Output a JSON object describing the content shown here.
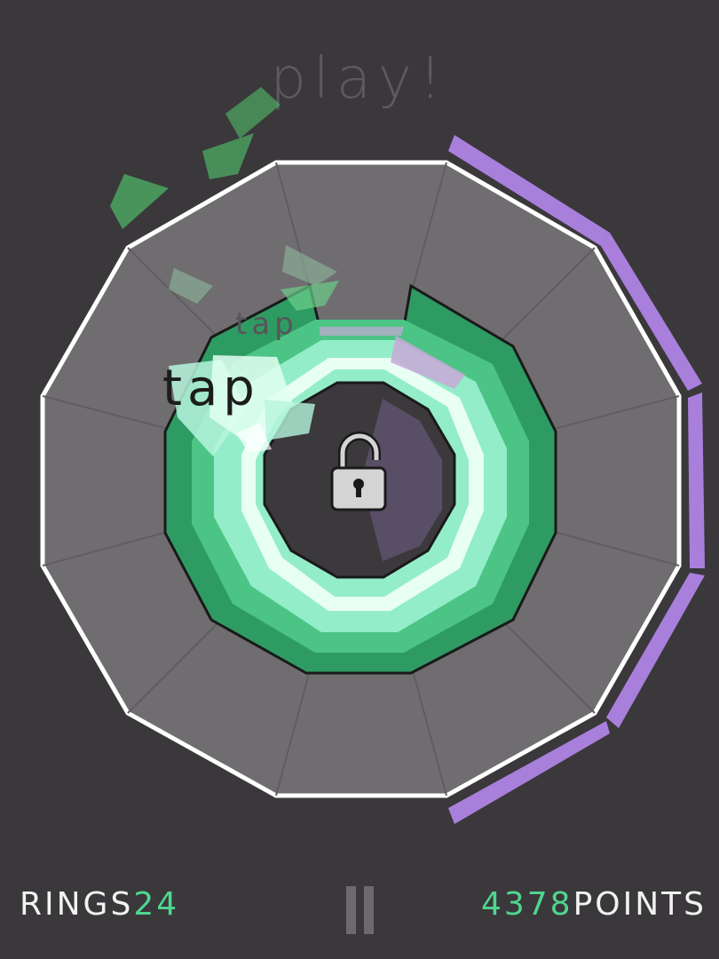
{
  "title": "play!",
  "hud": {
    "rings_label": "RINGS",
    "rings_value": "24",
    "points_value": "4378",
    "points_label": "POINTS"
  },
  "taps": [
    "tap",
    "tap"
  ],
  "board": {
    "sides": 12,
    "outer_fill": "#6f6d70",
    "outer_stroke": "#ffffff",
    "ring_dark": "#2e9b63",
    "ring_mid": "#4cc485",
    "ring_light": "#93edc9",
    "ring_white": "#e8fff3",
    "core": "#3b393c",
    "lock_progress_color": "#584e65",
    "progress_color": "#a97fdc",
    "lock_state": "unlocked"
  },
  "icons": {
    "lock": "padlock-open-icon",
    "pause": "pause-icon"
  }
}
